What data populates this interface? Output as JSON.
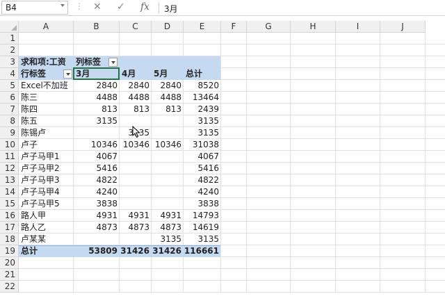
{
  "formula_bar": {
    "name_box": "B4",
    "fx_label": "fx",
    "cancel_icon": "x-icon",
    "enter_icon": "check-icon",
    "content": "3月"
  },
  "sheet": {
    "columns": [
      "A",
      "B",
      "C",
      "D",
      "E",
      "F",
      "G",
      "H",
      "I",
      "J"
    ],
    "rows": [
      "1",
      "2",
      "3",
      "4",
      "5",
      "6",
      "7",
      "8",
      "9",
      "10",
      "11",
      "12",
      "13",
      "14",
      "15",
      "16",
      "17",
      "18",
      "19",
      "20",
      "21",
      "22"
    ]
  },
  "pivot": {
    "value_field": "求和项:工资",
    "col_labels_title": "列标签",
    "row_labels_title": "行标签",
    "col_headers": [
      "3月",
      "4月",
      "5月",
      "总计"
    ],
    "rows": [
      {
        "label": "Excel不加班",
        "v": [
          "2840",
          "2840",
          "2840",
          "8520"
        ]
      },
      {
        "label": "陈三",
        "v": [
          "4488",
          "4488",
          "4488",
          "13464"
        ]
      },
      {
        "label": "陈四",
        "v": [
          "813",
          "813",
          "813",
          "2439"
        ]
      },
      {
        "label": "陈五",
        "v": [
          "3135",
          "",
          "",
          "3135"
        ]
      },
      {
        "label": "陈锡卢",
        "v": [
          "",
          "3135",
          "",
          "3135"
        ]
      },
      {
        "label": "卢子",
        "v": [
          "10346",
          "10346",
          "10346",
          "31038"
        ]
      },
      {
        "label": "卢子马甲1",
        "v": [
          "4067",
          "",
          "",
          "4067"
        ]
      },
      {
        "label": "卢子马甲2",
        "v": [
          "5416",
          "",
          "",
          "5416"
        ]
      },
      {
        "label": "卢子马甲3",
        "v": [
          "4822",
          "",
          "",
          "4822"
        ]
      },
      {
        "label": "卢子马甲4",
        "v": [
          "4240",
          "",
          "",
          "4240"
        ]
      },
      {
        "label": "卢子马甲5",
        "v": [
          "3838",
          "",
          "",
          "3838"
        ]
      },
      {
        "label": "路人甲",
        "v": [
          "4931",
          "4931",
          "4931",
          "14793"
        ]
      },
      {
        "label": "路人乙",
        "v": [
          "4873",
          "4873",
          "4873",
          "14619"
        ]
      },
      {
        "label": "卢某某",
        "v": [
          "",
          "",
          "3135",
          "3135"
        ]
      }
    ],
    "total": {
      "label": "总计",
      "v": [
        "53809",
        "31426",
        "31426",
        "116661"
      ]
    }
  },
  "colors": {
    "header_band": "#c5d9f1",
    "gridline": "#e2e2e2",
    "heading_bg": "#f0f0f0"
  }
}
